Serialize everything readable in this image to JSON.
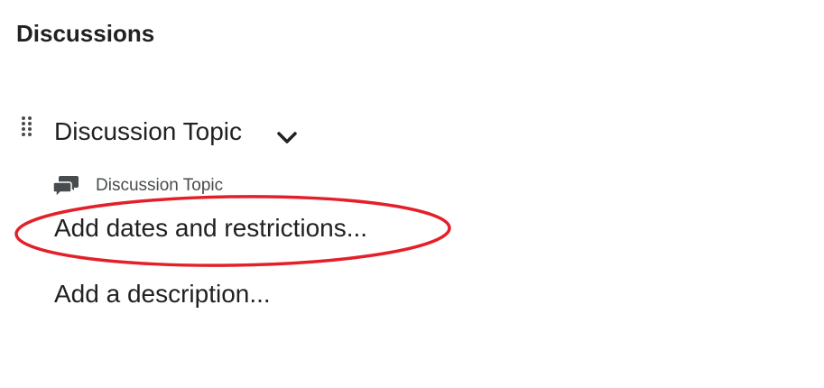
{
  "page": {
    "section_title": "Discussions"
  },
  "item": {
    "title": "Discussion Topic",
    "type_label": "Discussion Topic",
    "drag_icon": "drag-handle-icon",
    "expand_icon": "chevron-down-icon",
    "type_icon": "discussion-bubbles-icon"
  },
  "actions": {
    "add_dates": "Add dates and restrictions...",
    "add_description": "Add a description..."
  },
  "annotation": {
    "color": "#e3202a"
  }
}
